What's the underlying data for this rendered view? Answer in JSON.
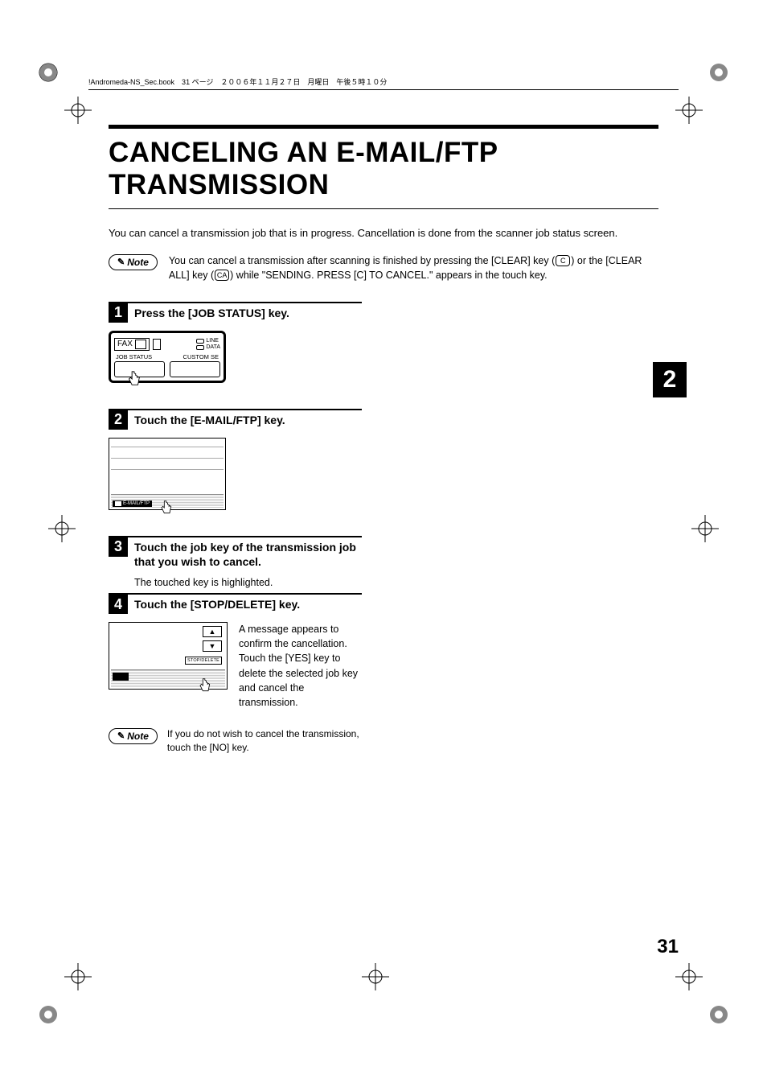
{
  "header": "!Andromeda-NS_Sec.book　31 ページ　２００６年１１月２７日　月曜日　午後５時１０分",
  "title": "CANCELING AN E-MAIL/FTP TRANSMISSION",
  "intro": "You can cancel a transmission job that is in progress. Cancellation is done from the scanner job status screen.",
  "note_label": "Note",
  "note1": {
    "text_a": "You can cancel a transmission after scanning is finished by pressing the [CLEAR] key (",
    "key_c": "C",
    "text_b": ") or the [CLEAR ALL] key (",
    "key_ca": "CA",
    "text_c": ") while \"SENDING. PRESS [C] TO CANCEL.\" appears in the touch key."
  },
  "steps": {
    "s1": {
      "num": "1",
      "title": "Press the [JOB STATUS] key."
    },
    "s2": {
      "num": "2",
      "title": "Touch the [E-MAIL/FTP] key."
    },
    "s3": {
      "num": "3",
      "title": "Touch the job key of the transmission job that you wish to cancel.",
      "body": "The touched key is highlighted."
    },
    "s4": {
      "num": "4",
      "title": "Touch the [STOP/DELETE] key.",
      "desc": "A message appears to confirm the cancellation. Touch the [YES] key to delete the selected job key and cancel the transmission."
    }
  },
  "illus1": {
    "fax": "FAX",
    "line": "LINE",
    "data": "DATA",
    "job_status": "JOB STATUS",
    "custom": "CUSTOM SE"
  },
  "illus2": {
    "tab": "E-MAIL/FTP"
  },
  "illus4": {
    "stop": "STOP/DELETE"
  },
  "note2": "If you do not wish to cancel the transmission, touch the [NO] key.",
  "section_tab": "2",
  "page_number": "31"
}
